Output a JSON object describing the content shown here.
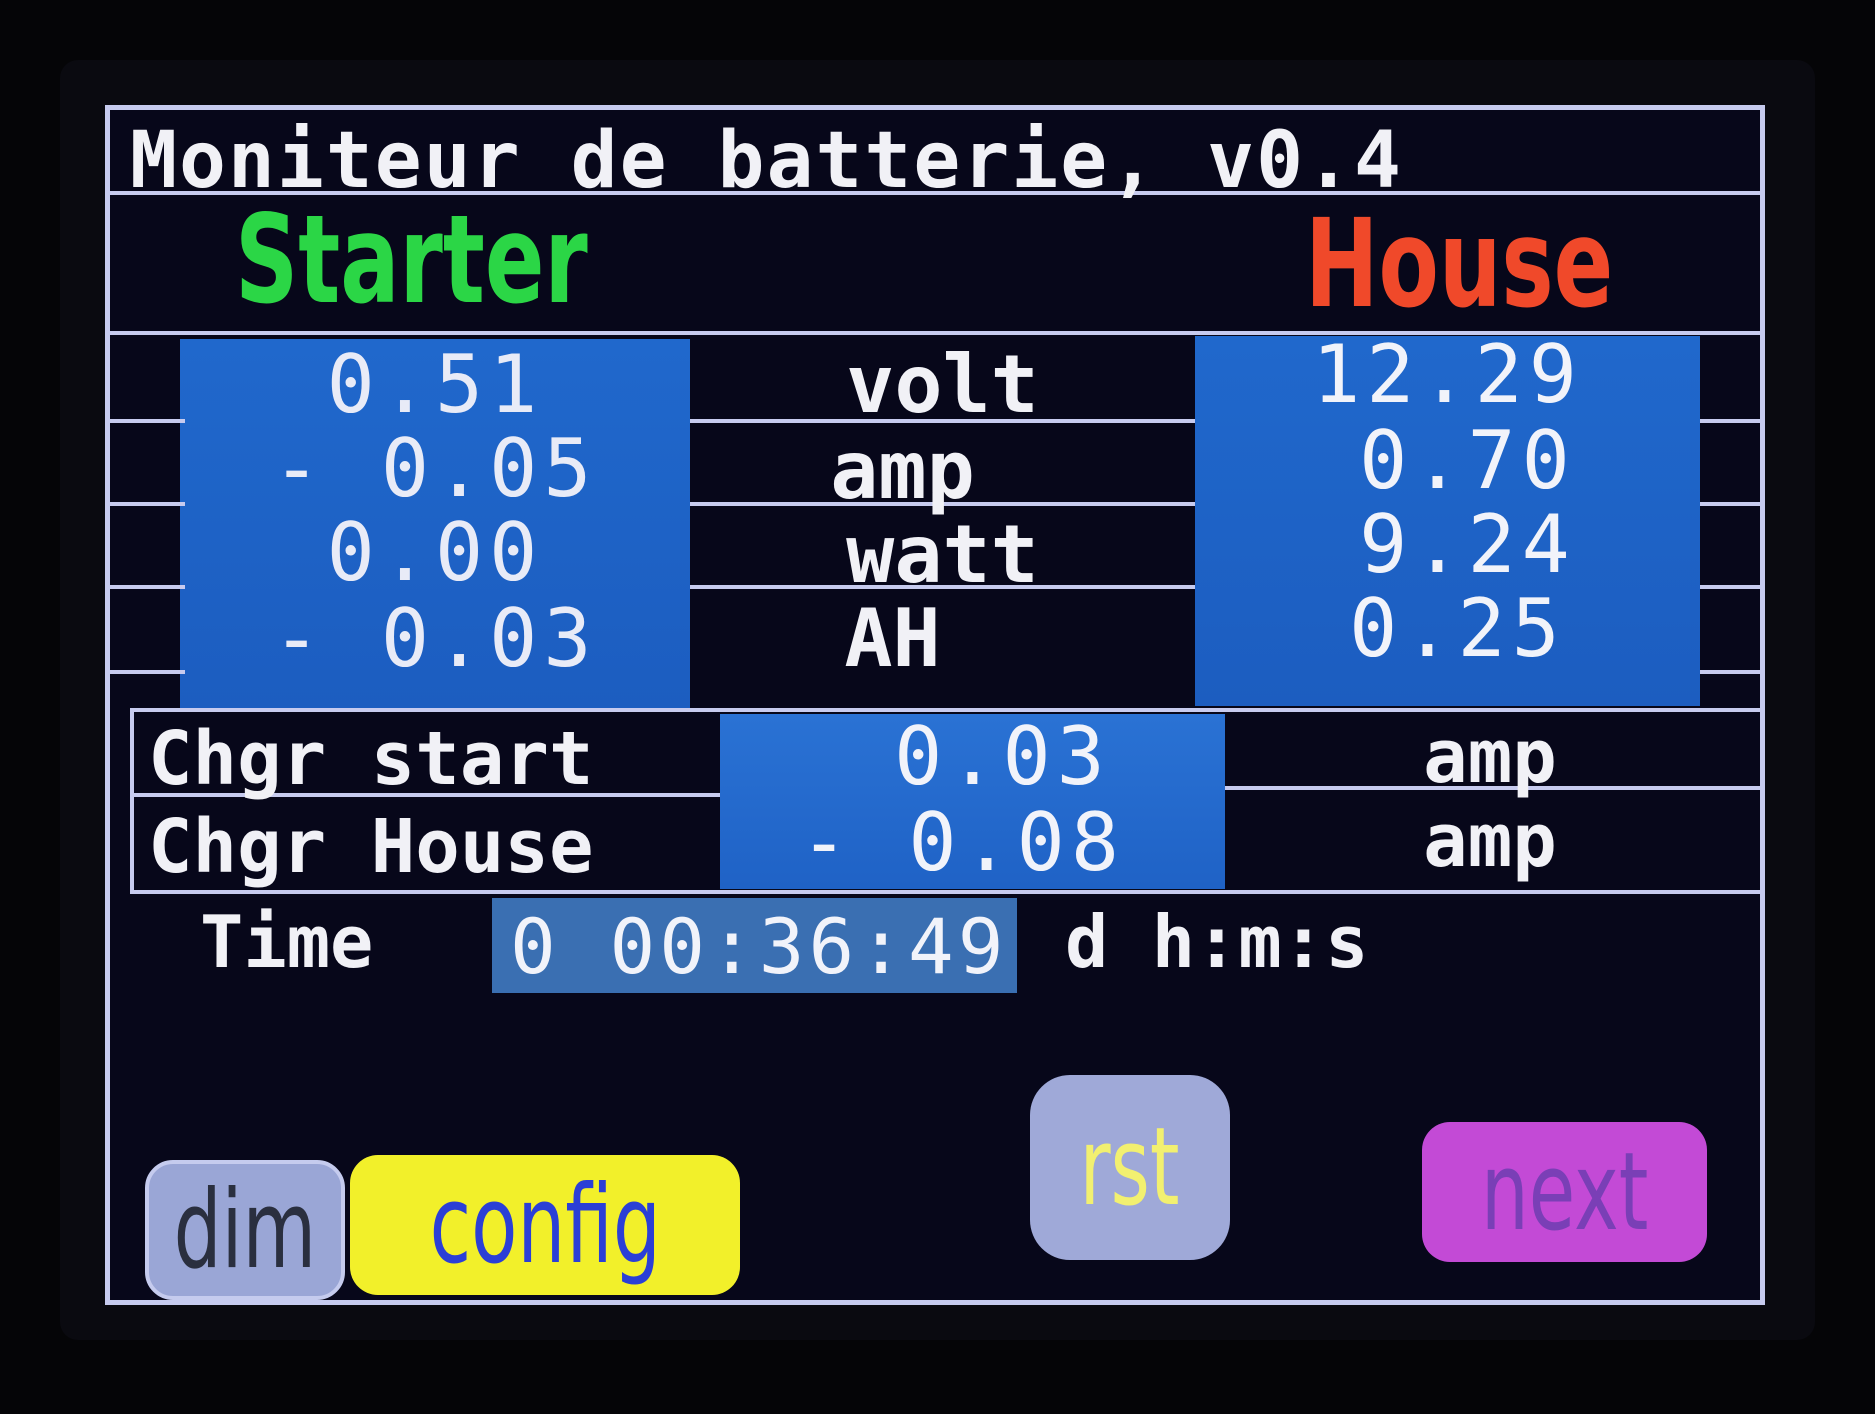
{
  "app": {
    "title": "Moniteur de batterie, v0.4"
  },
  "columns": {
    "starter_label": "Starter",
    "house_label": "House"
  },
  "readings": [
    {
      "starter": "0.51",
      "unit": "volt",
      "house": "12.29"
    },
    {
      "starter": "- 0.05",
      "unit": "amp",
      "house": "0.70"
    },
    {
      "starter": "0.00",
      "unit": "watt",
      "house": "9.24"
    },
    {
      "starter": "- 0.03",
      "unit": "AH",
      "house": "0.25"
    }
  ],
  "chargers": [
    {
      "label": "Chgr start",
      "value": "0.03",
      "unit": "amp"
    },
    {
      "label": "Chgr House",
      "value": "- 0.08",
      "unit": "amp"
    }
  ],
  "time": {
    "label": "Time",
    "value": "0 00:36:49",
    "unit": "d h:m:s"
  },
  "buttons": {
    "dim": "dim",
    "config": "config",
    "rst": "rst",
    "next": "next"
  },
  "colors": {
    "starter": "#2bd646",
    "house": "#f0492a",
    "value_cell": "#1c5dc0",
    "config_button": "#f2f02a",
    "next_button": "#c34ad6",
    "rst_button": "#9fa9d8",
    "dim_button": "#9aa6d6"
  }
}
